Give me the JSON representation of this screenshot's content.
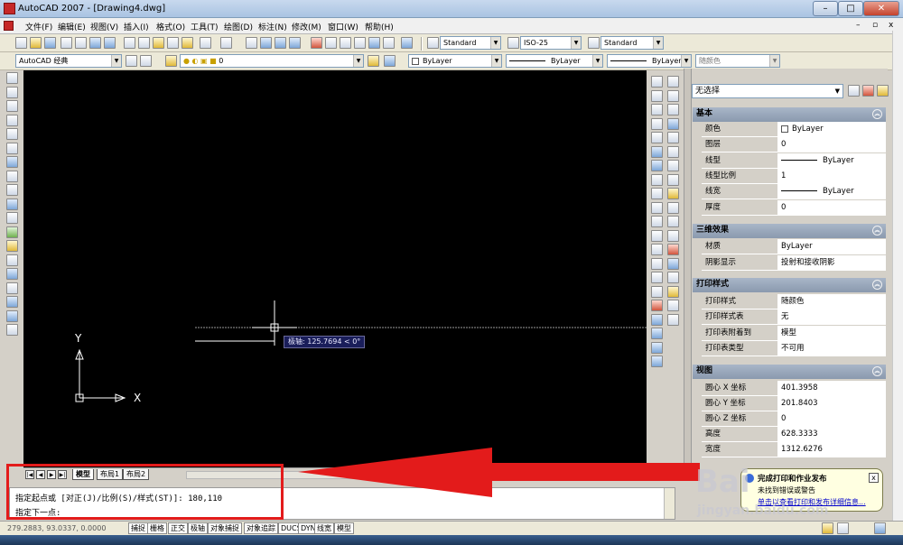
{
  "window": {
    "title": "AutoCAD 2007 - [Drawing4.dwg]",
    "min": "–",
    "max": "□",
    "close": "✕",
    "doc_min": "–",
    "doc_max": "▫",
    "doc_close": "x"
  },
  "menu": [
    "文件(F)",
    "编辑(E)",
    "视图(V)",
    "插入(I)",
    "格式(O)",
    "工具(T)",
    "绘图(D)",
    "标注(N)",
    "修改(M)",
    "窗口(W)",
    "帮助(H)"
  ],
  "toolbar": {
    "text_style": "Standard",
    "dim_style": "ISO-25",
    "table_style": "Standard",
    "workspace": "AutoCAD 经典",
    "layer": "0",
    "color": "ByLayer",
    "linetype": "ByLayer",
    "lineweight": "ByLayer",
    "plot_style": "随颜色"
  },
  "canvas": {
    "ucs_y": "Y",
    "ucs_x": "X",
    "tooltip": "极轴: 125.7694 < 0°"
  },
  "tabs": {
    "first": "|◀",
    "prev": "◀",
    "next": "▶",
    "last": "▶|",
    "model": "模型",
    "layout1": "布局1",
    "layout2": "布局2"
  },
  "command": {
    "line1": "指定起点或 [对正(J)/比例(S)/样式(ST)]:  180,110",
    "line2": "指定下一点:"
  },
  "status": {
    "coords": "279.2883, 93.0337, 0.0000",
    "buttons": [
      "捕捉",
      "栅格",
      "正交",
      "极轴",
      "对象捕捉",
      "对象追踪",
      "DUCS",
      "DYN",
      "线宽",
      "模型"
    ]
  },
  "properties": {
    "selection": "无选择",
    "sections": [
      {
        "title": "基本",
        "rows": [
          {
            "k": "颜色",
            "v": "ByLayer"
          },
          {
            "k": "图层",
            "v": "0"
          },
          {
            "k": "线型",
            "v": "ByLayer"
          },
          {
            "k": "线型比例",
            "v": "1"
          },
          {
            "k": "线宽",
            "v": "ByLayer"
          },
          {
            "k": "厚度",
            "v": "0"
          }
        ]
      },
      {
        "title": "三维效果",
        "rows": [
          {
            "k": "材质",
            "v": "ByLayer"
          },
          {
            "k": "阴影显示",
            "v": "投射和接收阴影"
          }
        ]
      },
      {
        "title": "打印样式",
        "rows": [
          {
            "k": "打印样式",
            "v": "随颜色"
          },
          {
            "k": "打印样式表",
            "v": "无"
          },
          {
            "k": "打印表附着到",
            "v": "模型"
          },
          {
            "k": "打印表类型",
            "v": "不可用"
          }
        ]
      },
      {
        "title": "视图",
        "rows": [
          {
            "k": "圆心 X 坐标",
            "v": "401.3958"
          },
          {
            "k": "圆心 Y 坐标",
            "v": "201.8403"
          },
          {
            "k": "圆心 Z 坐标",
            "v": "0"
          },
          {
            "k": "高度",
            "v": "628.3333"
          },
          {
            "k": "宽度",
            "v": "1312.6276"
          }
        ]
      }
    ],
    "collapse": "︽"
  },
  "balloon": {
    "title": "完成打印和作业发布",
    "line1": "未找到错误或警告",
    "link": "单击以查看打印和发布详细信息..."
  },
  "watermark": {
    "brand": "Bai",
    "site": "jingyan.baidu.com"
  },
  "colors": {
    "annotation_red": "#e31b1b",
    "canvas": "#000000"
  }
}
